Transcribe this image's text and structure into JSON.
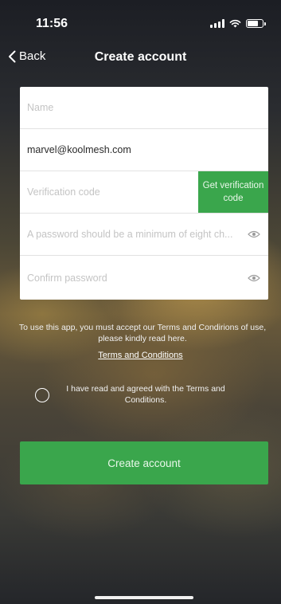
{
  "status_bar": {
    "time": "11:56"
  },
  "nav": {
    "back_label": "Back",
    "title": "Create account"
  },
  "form": {
    "name_placeholder": "Name",
    "email_value": "marvel@koolmesh.com",
    "verification_placeholder": "Verification code",
    "get_code_label": "Get verification code",
    "password_placeholder": "A password should be a minimum of eight ch...",
    "confirm_placeholder": "Confirm password"
  },
  "terms": {
    "notice": "To use this app, you must accept our Terms and Condirions of use, please kindly read here.",
    "link_label": "Terms and Conditions",
    "agree_label": "I have read and agreed with the Terms and Conditions."
  },
  "actions": {
    "create_label": "Create account"
  },
  "colors": {
    "accent": "#3aa64c"
  },
  "icons": [
    "chevron-left-icon",
    "signal-icon",
    "wifi-icon",
    "battery-icon",
    "eye-icon"
  ]
}
